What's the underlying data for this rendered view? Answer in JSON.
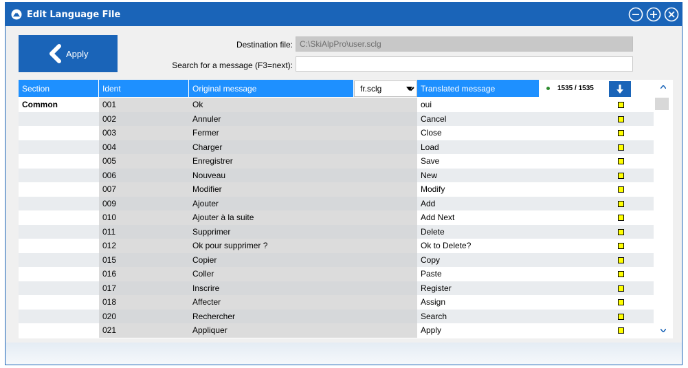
{
  "window": {
    "title": "Edit Language File"
  },
  "toolbar": {
    "apply_label": "Apply"
  },
  "form": {
    "destination_label": "Destination file:",
    "destination_value": "C:\\SkiAlpPro\\user.sclg",
    "search_label": "Search for a message (F3=next):",
    "search_value": ""
  },
  "grid": {
    "headers": {
      "section": "Section",
      "ident": "Ident",
      "original": "Original message",
      "translated": "Translated message"
    },
    "language_select": "fr.sclg",
    "count": "1535 / 1535",
    "rows": [
      {
        "section": "Common",
        "ident": "001",
        "original": "Ok",
        "translated": "oui"
      },
      {
        "section": "",
        "ident": "002",
        "original": "Annuler",
        "translated": "Cancel"
      },
      {
        "section": "",
        "ident": "003",
        "original": "Fermer",
        "translated": "Close"
      },
      {
        "section": "",
        "ident": "004",
        "original": "Charger",
        "translated": "Load"
      },
      {
        "section": "",
        "ident": "005",
        "original": "Enregistrer",
        "translated": "Save"
      },
      {
        "section": "",
        "ident": "006",
        "original": "Nouveau",
        "translated": "New"
      },
      {
        "section": "",
        "ident": "007",
        "original": "Modifier",
        "translated": "Modify"
      },
      {
        "section": "",
        "ident": "009",
        "original": "Ajouter",
        "translated": "Add"
      },
      {
        "section": "",
        "ident": "010",
        "original": "Ajouter à la suite",
        "translated": "Add Next"
      },
      {
        "section": "",
        "ident": "011",
        "original": "Supprimer",
        "translated": "Delete"
      },
      {
        "section": "",
        "ident": "012",
        "original": "Ok pour supprimer ?",
        "translated": "Ok to Delete?"
      },
      {
        "section": "",
        "ident": "015",
        "original": "Copier",
        "translated": "Copy"
      },
      {
        "section": "",
        "ident": "016",
        "original": "Coller",
        "translated": "Paste"
      },
      {
        "section": "",
        "ident": "017",
        "original": "Inscrire",
        "translated": "Register"
      },
      {
        "section": "",
        "ident": "018",
        "original": "Affecter",
        "translated": "Assign"
      },
      {
        "section": "",
        "ident": "020",
        "original": "Rechercher",
        "translated": "Search"
      },
      {
        "section": "",
        "ident": "021",
        "original": "Appliquer",
        "translated": "Apply"
      }
    ]
  },
  "colors": {
    "title_bar": "#1a64b8",
    "header": "#1e90ff",
    "flag": "#ffff00"
  },
  "icons": {
    "app": "app-logo-icon",
    "minimize": "minimize-icon",
    "maximize": "maximize-icon",
    "close": "close-icon",
    "apply": "chevron-left-icon",
    "download": "arrow-down-icon"
  }
}
